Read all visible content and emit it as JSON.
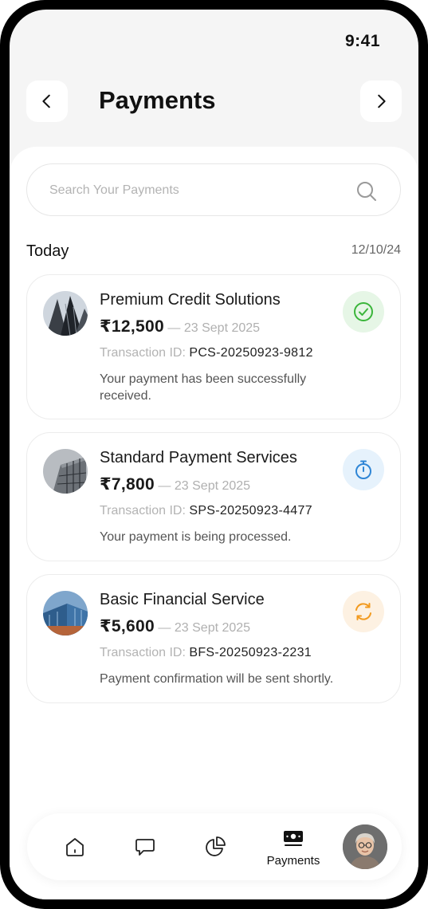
{
  "status_bar": {
    "time": "9:41"
  },
  "header": {
    "title": "Payments"
  },
  "search": {
    "placeholder": "Search Your Payments"
  },
  "section": {
    "label": "Today",
    "date": "12/10/24"
  },
  "payments": [
    {
      "name": "Premium Credit Solutions",
      "amount": "₹12,500",
      "separator": "—",
      "date": "23 Sept 2025",
      "txn_label": "Transaction ID:",
      "txn_id": "PCS-20250923-9812",
      "message": "Your payment has been successfully received.",
      "status_icon": "check-circle-icon",
      "status_color": "#3ab53a",
      "status_bg": "#e6f6e6"
    },
    {
      "name": "Standard Payment Services",
      "amount": "₹7,800",
      "separator": "—",
      "date": "23 Sept 2025",
      "txn_label": "Transaction ID:",
      "txn_id": "SPS-20250923-4477",
      "message": "Your payment is being processed.",
      "status_icon": "stopwatch-icon",
      "status_color": "#2f86d6",
      "status_bg": "#e6f2fc"
    },
    {
      "name": "Basic Financial Service",
      "amount": "₹5,600",
      "separator": "—",
      "date": "23 Sept 2025",
      "txn_label": "Transaction ID:",
      "txn_id": "BFS-20250923-2231",
      "message": "Payment confirmation will be sent shortly.",
      "status_icon": "refresh-icon",
      "status_color": "#f29a1f",
      "status_bg": "#fdf1e2"
    }
  ],
  "bottom_nav": {
    "items": [
      {
        "icon": "home-icon",
        "label": ""
      },
      {
        "icon": "chat-icon",
        "label": ""
      },
      {
        "icon": "pie-chart-icon",
        "label": ""
      },
      {
        "icon": "cash-icon",
        "label": "Payments"
      }
    ],
    "profile_icon": "profile-avatar"
  }
}
